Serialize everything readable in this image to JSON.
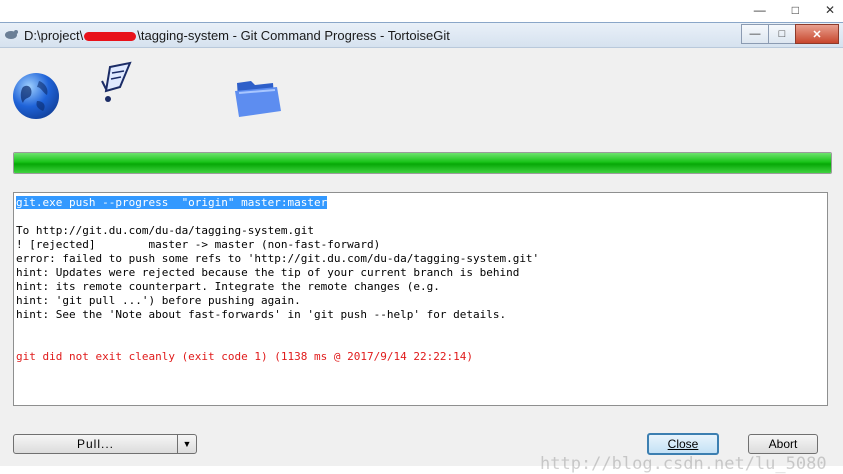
{
  "window": {
    "title_prefix": "D:\\project\\",
    "title_suffix": "\\tagging-system - Git Command Progress - TortoiseGit",
    "minimize": "—",
    "maximize": "□",
    "close": "✕",
    "outer_minimize": "—",
    "outer_maximize": "□",
    "outer_close": "✕"
  },
  "icons": [
    "globe-icon",
    "flying-paper-icon",
    "folder-icon"
  ],
  "progress": {
    "percent": 100,
    "color": "#19c319"
  },
  "log": {
    "lines": [
      {
        "text": "git.exe push --progress  \"origin\" master:master",
        "style": "selected"
      },
      {
        "text": "",
        "style": ""
      },
      {
        "text": "To http://git.du.com/du-da/tagging-system.git",
        "style": ""
      },
      {
        "text": "! [rejected]        master -> master (non-fast-forward)",
        "style": ""
      },
      {
        "text": "error: failed to push some refs to 'http://git.du.com/du-da/tagging-system.git'",
        "style": ""
      },
      {
        "text": "hint: Updates were rejected because the tip of your current branch is behind",
        "style": ""
      },
      {
        "text": "hint: its remote counterpart. Integrate the remote changes (e.g.",
        "style": ""
      },
      {
        "text": "hint: 'git pull ...') before pushing again.",
        "style": ""
      },
      {
        "text": "hint: See the 'Note about fast-forwards' in 'git push --help' for details.",
        "style": ""
      },
      {
        "text": "",
        "style": ""
      },
      {
        "text": "",
        "style": ""
      },
      {
        "text": "git did not exit cleanly (exit code 1) (1138 ms @ 2017/9/14 22:22:14)",
        "style": "error"
      }
    ]
  },
  "buttons": {
    "pull": "Pull...",
    "pull_arrow": "▼",
    "close": "Close",
    "abort": "Abort"
  },
  "watermark": "http://blog.csdn.net/lu_5080",
  "colors": {
    "selection": "#3399ff",
    "error": "#e01b1b"
  }
}
